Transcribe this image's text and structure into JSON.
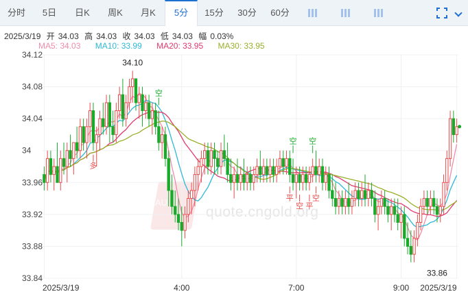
{
  "toolbar": {
    "tabs": [
      {
        "label": "分时",
        "active": false
      },
      {
        "label": "5日",
        "active": false
      },
      {
        "label": "日K",
        "active": false
      },
      {
        "label": "周K",
        "active": false
      },
      {
        "label": "月K",
        "active": false
      },
      {
        "label": "5分",
        "active": true
      },
      {
        "label": "15分",
        "active": false
      },
      {
        "label": "30分",
        "active": false
      },
      {
        "label": "60分",
        "active": false
      }
    ],
    "icons": [
      "candlestick-icon",
      "bar-chart-icon",
      "line-style-icon",
      "fullscreen-icon",
      "more-icon"
    ]
  },
  "quote": {
    "date": "2025/3/19",
    "open_label": "开",
    "open": "34.03",
    "high_label": "高",
    "high": "34.03",
    "close_label": "收",
    "close": "34.03",
    "low_label": "低",
    "low": "34.03",
    "change_label": "幅",
    "change": "0.03%"
  },
  "ma": [
    {
      "label": "MA5: 34.03",
      "color": "#f08caa"
    },
    {
      "label": "MA10: 33.99",
      "color": "#2fb8d6"
    },
    {
      "label": "MA20: 33.95",
      "color": "#e0396e"
    },
    {
      "label": "MA30: 33.95",
      "color": "#9aae2a"
    }
  ],
  "watermark": {
    "site": "quote.cngold.org",
    "logo": "AU"
  },
  "colors": {
    "up": "#e84a4a",
    "down": "#1aaa2b",
    "grid": "#eef0f3"
  },
  "chart_data": {
    "type": "candlestick",
    "interval": "5分",
    "ylim": [
      33.84,
      34.12
    ],
    "y_ticks": [
      "34.12",
      "34.08",
      "34.04",
      "34",
      "33.96",
      "33.92",
      "33.88",
      "33.84"
    ],
    "x_tick_labels": [
      "2025/3/19",
      "4:00",
      "7:00",
      "9:00",
      "2025/3/19"
    ],
    "x_tick_index": [
      0,
      42,
      77,
      109,
      136
    ],
    "annotations": [
      {
        "text": "34.10",
        "index": 27,
        "price": 34.1,
        "where": "above"
      },
      {
        "text": "33.86",
        "index": 120,
        "price": 33.86,
        "where": "below"
      }
    ],
    "signals": [
      {
        "text": "空",
        "index": 35,
        "dir": "down"
      },
      {
        "text": "多",
        "index": 15,
        "dir": "up"
      },
      {
        "text": "空",
        "index": 76,
        "dir": "down"
      },
      {
        "text": "空",
        "index": 82,
        "dir": "down"
      },
      {
        "text": "平",
        "index": 75,
        "dir": "up"
      },
      {
        "text": "空",
        "index": 78,
        "dir": "up"
      },
      {
        "text": "平",
        "index": 81,
        "dir": "up"
      },
      {
        "text": "空",
        "index": 83,
        "dir": "up"
      }
    ],
    "candles": [
      [
        33.97,
        33.98,
        33.95,
        33.96
      ],
      [
        33.96,
        34.0,
        33.95,
        33.99
      ],
      [
        33.99,
        34.0,
        33.96,
        33.97
      ],
      [
        33.97,
        33.99,
        33.95,
        33.98
      ],
      [
        33.98,
        34.01,
        33.96,
        33.96
      ],
      [
        33.96,
        34.0,
        33.95,
        33.99
      ],
      [
        33.99,
        34.01,
        33.97,
        33.98
      ],
      [
        33.98,
        34.01,
        33.96,
        34.0
      ],
      [
        34.0,
        34.02,
        33.98,
        33.99
      ],
      [
        33.99,
        34.01,
        33.97,
        34.01
      ],
      [
        34.01,
        34.03,
        33.99,
        34.0
      ],
      [
        34.0,
        34.04,
        33.99,
        34.03
      ],
      [
        34.03,
        34.04,
        34.0,
        34.01
      ],
      [
        34.01,
        34.04,
        33.99,
        34.03
      ],
      [
        34.03,
        34.06,
        34.01,
        34.05
      ],
      [
        34.05,
        34.06,
        34.0,
        34.01
      ],
      [
        34.01,
        34.03,
        33.98,
        34.02
      ],
      [
        34.02,
        34.05,
        34.0,
        34.04
      ],
      [
        34.04,
        34.06,
        34.02,
        34.03
      ],
      [
        34.03,
        34.07,
        34.02,
        34.06
      ],
      [
        34.06,
        34.07,
        34.01,
        34.03
      ],
      [
        34.03,
        34.05,
        34.01,
        34.02
      ],
      [
        34.02,
        34.06,
        34.01,
        34.05
      ],
      [
        34.05,
        34.08,
        34.04,
        34.07
      ],
      [
        34.07,
        34.09,
        34.03,
        34.04
      ],
      [
        34.04,
        34.07,
        34.03,
        34.06
      ],
      [
        34.06,
        34.09,
        34.05,
        34.08
      ],
      [
        34.08,
        34.1,
        34.06,
        34.09
      ],
      [
        34.09,
        34.09,
        34.05,
        34.06
      ],
      [
        34.06,
        34.08,
        34.04,
        34.07
      ],
      [
        34.07,
        34.08,
        34.03,
        34.05
      ],
      [
        34.05,
        34.07,
        34.04,
        34.06
      ],
      [
        34.06,
        34.07,
        34.03,
        34.04
      ],
      [
        34.04,
        34.06,
        34.02,
        34.05
      ],
      [
        34.05,
        34.06,
        34.02,
        34.03
      ],
      [
        34.03,
        34.05,
        34.0,
        34.01
      ],
      [
        34.01,
        34.03,
        33.99,
        34.02
      ],
      [
        34.02,
        34.03,
        33.98,
        33.99
      ],
      [
        33.99,
        34.0,
        33.93,
        33.95
      ],
      [
        33.95,
        33.97,
        33.92,
        33.93
      ],
      [
        33.93,
        33.95,
        33.91,
        33.92
      ],
      [
        33.92,
        33.94,
        33.9,
        33.91
      ],
      [
        33.91,
        33.93,
        33.88,
        33.9
      ],
      [
        33.9,
        33.93,
        33.89,
        33.92
      ],
      [
        33.92,
        33.95,
        33.91,
        33.94
      ],
      [
        33.94,
        33.96,
        33.92,
        33.95
      ],
      [
        33.95,
        33.98,
        33.93,
        33.97
      ],
      [
        33.97,
        33.99,
        33.95,
        33.98
      ],
      [
        33.98,
        34.0,
        33.96,
        33.99
      ],
      [
        33.99,
        34.01,
        33.97,
        34.0
      ],
      [
        34.0,
        34.01,
        33.97,
        33.98
      ],
      [
        33.98,
        34.01,
        33.97,
        34.0
      ],
      [
        34.0,
        34.01,
        33.97,
        33.99
      ],
      [
        33.99,
        34.0,
        33.97,
        33.98
      ],
      [
        33.98,
        34.01,
        33.97,
        34.0
      ],
      [
        34.0,
        34.02,
        33.98,
        33.99
      ],
      [
        33.99,
        34.01,
        33.96,
        33.97
      ],
      [
        33.97,
        33.99,
        33.95,
        33.96
      ],
      [
        33.96,
        33.98,
        33.94,
        33.97
      ],
      [
        33.97,
        33.99,
        33.95,
        33.96
      ],
      [
        33.96,
        33.98,
        33.95,
        33.97
      ],
      [
        33.97,
        33.99,
        33.95,
        33.96
      ],
      [
        33.96,
        33.98,
        33.95,
        33.97
      ],
      [
        33.97,
        33.98,
        33.95,
        33.96
      ],
      [
        33.96,
        33.98,
        33.95,
        33.97
      ],
      [
        33.97,
        33.99,
        33.96,
        33.98
      ],
      [
        33.98,
        34.0,
        33.96,
        33.97
      ],
      [
        33.97,
        33.99,
        33.96,
        33.98
      ],
      [
        33.98,
        33.99,
        33.96,
        33.97
      ],
      [
        33.97,
        33.99,
        33.96,
        33.98
      ],
      [
        33.98,
        33.99,
        33.96,
        33.97
      ],
      [
        33.97,
        33.99,
        33.96,
        33.98
      ],
      [
        33.98,
        34.0,
        33.97,
        33.99
      ],
      [
        33.99,
        34.0,
        33.97,
        33.98
      ],
      [
        33.98,
        34.0,
        33.97,
        33.99
      ],
      [
        33.99,
        34.0,
        33.96,
        33.97
      ],
      [
        33.97,
        33.99,
        33.95,
        33.96
      ],
      [
        33.96,
        33.98,
        33.94,
        33.97
      ],
      [
        33.97,
        33.98,
        33.95,
        33.96
      ],
      [
        33.96,
        33.98,
        33.95,
        33.97
      ],
      [
        33.97,
        33.98,
        33.95,
        33.96
      ],
      [
        33.96,
        33.98,
        33.95,
        33.97
      ],
      [
        33.97,
        33.99,
        33.96,
        33.98
      ],
      [
        33.98,
        34.0,
        33.96,
        33.97
      ],
      [
        33.97,
        33.99,
        33.96,
        33.98
      ],
      [
        33.98,
        33.99,
        33.95,
        33.96
      ],
      [
        33.96,
        33.98,
        33.95,
        33.97
      ],
      [
        33.97,
        33.98,
        33.94,
        33.95
      ],
      [
        33.95,
        33.97,
        33.93,
        33.94
      ],
      [
        33.94,
        33.96,
        33.92,
        33.93
      ],
      [
        33.93,
        33.95,
        33.92,
        33.94
      ],
      [
        33.94,
        33.95,
        33.92,
        33.93
      ],
      [
        33.93,
        33.95,
        33.92,
        33.94
      ],
      [
        33.94,
        33.96,
        33.92,
        33.93
      ],
      [
        33.93,
        33.95,
        33.92,
        33.94
      ],
      [
        33.94,
        33.96,
        33.93,
        33.95
      ],
      [
        33.95,
        33.96,
        33.93,
        33.94
      ],
      [
        33.94,
        33.96,
        33.93,
        33.95
      ],
      [
        33.95,
        33.97,
        33.93,
        33.94
      ],
      [
        33.94,
        33.96,
        33.93,
        33.95
      ],
      [
        33.95,
        33.96,
        33.93,
        33.94
      ],
      [
        33.94,
        33.95,
        33.91,
        33.92
      ],
      [
        33.92,
        33.94,
        33.9,
        33.93
      ],
      [
        33.93,
        33.95,
        33.92,
        33.94
      ],
      [
        33.94,
        33.95,
        33.92,
        33.93
      ],
      [
        33.93,
        33.94,
        33.91,
        33.92
      ],
      [
        33.92,
        33.94,
        33.9,
        33.93
      ],
      [
        33.93,
        33.94,
        33.91,
        33.92
      ],
      [
        33.92,
        33.94,
        33.9,
        33.91
      ],
      [
        33.91,
        33.93,
        33.89,
        33.92
      ],
      [
        33.92,
        33.93,
        33.88,
        33.89
      ],
      [
        33.89,
        33.91,
        33.87,
        33.88
      ],
      [
        33.88,
        33.9,
        33.86,
        33.87
      ],
      [
        33.87,
        33.9,
        33.86,
        33.89
      ],
      [
        33.89,
        33.92,
        33.88,
        33.91
      ],
      [
        33.91,
        33.94,
        33.9,
        33.93
      ],
      [
        33.93,
        33.95,
        33.92,
        33.94
      ],
      [
        33.94,
        33.95,
        33.92,
        33.93
      ],
      [
        33.93,
        33.95,
        33.92,
        33.94
      ],
      [
        33.94,
        33.95,
        33.92,
        33.93
      ],
      [
        33.93,
        33.94,
        33.91,
        33.92
      ],
      [
        33.92,
        33.94,
        33.91,
        33.93
      ],
      [
        33.93,
        33.97,
        33.92,
        33.96
      ],
      [
        33.96,
        34.0,
        33.95,
        33.99
      ],
      [
        33.99,
        34.05,
        33.98,
        34.04
      ],
      [
        34.04,
        34.05,
        34.01,
        34.02
      ],
      [
        34.02,
        34.04,
        34.01,
        34.03
      ]
    ]
  }
}
